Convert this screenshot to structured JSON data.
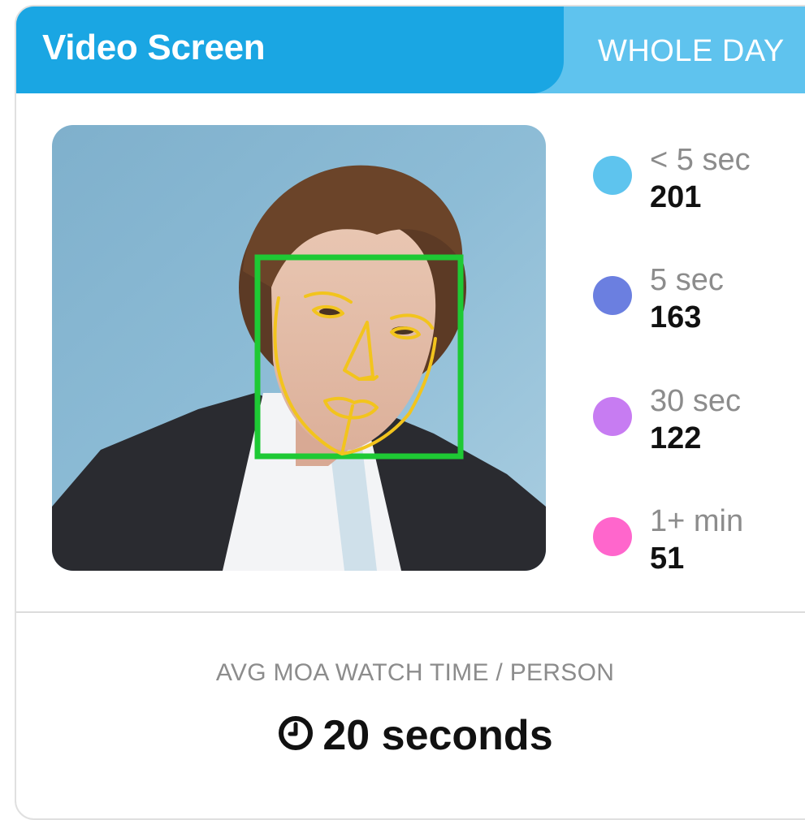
{
  "header": {
    "title": "Video Screen",
    "period": "WHOLE DAY"
  },
  "photo": {
    "face_box_color": "#1ec934",
    "landmark_color": "#f2c41d"
  },
  "legend": [
    {
      "label": "< 5 sec",
      "value": "201",
      "color": "#5ec4ee"
    },
    {
      "label": "5 sec",
      "value": "163",
      "color": "#6b7fe0"
    },
    {
      "label": "30 sec",
      "value": "122",
      "color": "#c77cf2"
    },
    {
      "label": "1+ min",
      "value": "51",
      "color": "#ff66cc"
    }
  ],
  "summary": {
    "label": "AVG MOA WATCH TIME / PERSON",
    "value": "20 seconds",
    "icon": "clock-icon"
  }
}
